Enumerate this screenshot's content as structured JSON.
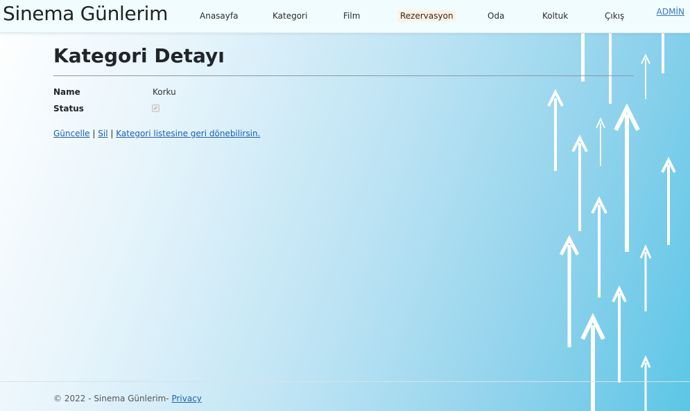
{
  "brand": "Sinema Günlerim",
  "nav": {
    "items": [
      "Anasayfa",
      "Kategori",
      "Film",
      "Rezervasyon",
      "Oda",
      "Koltuk",
      "Çıkış"
    ],
    "active": "Rezervasyon",
    "user_link": "ADMİN"
  },
  "page": {
    "title": "Kategori Detayı",
    "fields": [
      {
        "label": "Name",
        "value": "Korku"
      },
      {
        "label": "Status",
        "value": true
      }
    ],
    "links": {
      "update": "Güncelle",
      "delete": "Sil",
      "back": "Kategori listesine geri dönebilirsin.",
      "separator": "|"
    }
  },
  "footer": {
    "text": "© 2022 - Sinema Günlerim-",
    "privacy": "Privacy"
  },
  "colors": {
    "accent": "#5cc6e6",
    "link": "#1b5fb0",
    "active_nav_bg": "#fdf0e2"
  }
}
